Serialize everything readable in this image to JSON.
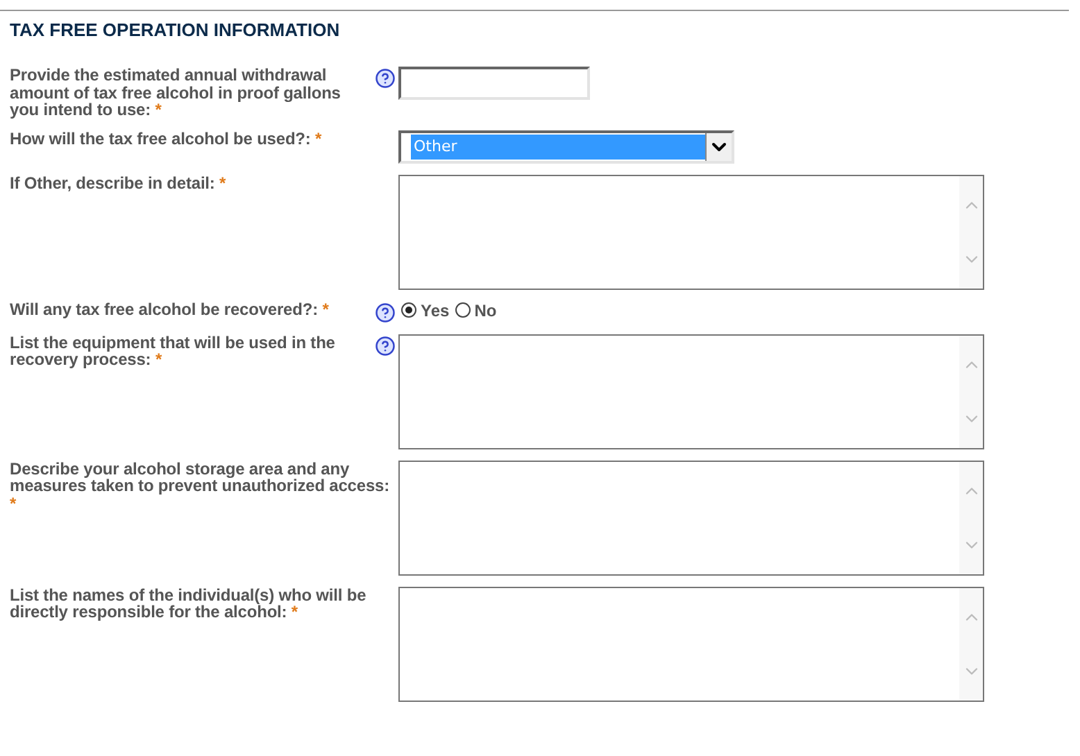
{
  "section": {
    "title": "TAX FREE OPERATION INFORMATION"
  },
  "fields": [
    {
      "kind": "text",
      "label": "Provide the estimated annual withdrawal amount of tax free alcohol in proof gallons you intend to use:",
      "required": "*",
      "help": true
    },
    {
      "kind": "select",
      "label": "How will the tax free alcohol be used?:",
      "required": "*",
      "help": false,
      "value": "Other",
      "focused": true
    },
    {
      "kind": "textarea",
      "label": "If Other, describe in detail:",
      "required": "*",
      "help": false
    },
    {
      "kind": "radio",
      "label": "Will any tax free alcohol be recovered?:",
      "required": "*",
      "help": true,
      "options": [
        {
          "label": "Yes",
          "selected": true
        },
        {
          "label": "No",
          "selected": false
        }
      ]
    },
    {
      "kind": "textarea",
      "label": "List the equipment that will be used in the recovery process:",
      "required": "*",
      "help": true
    },
    {
      "kind": "textarea",
      "label": "Describe your alcohol storage area and any measures taken to prevent unauthorized access:",
      "required": "*",
      "help": false
    },
    {
      "kind": "textarea",
      "label": "List the names of the individual(s) who will be directly responsible for the alcohol:",
      "required": "*",
      "help": false
    }
  ]
}
